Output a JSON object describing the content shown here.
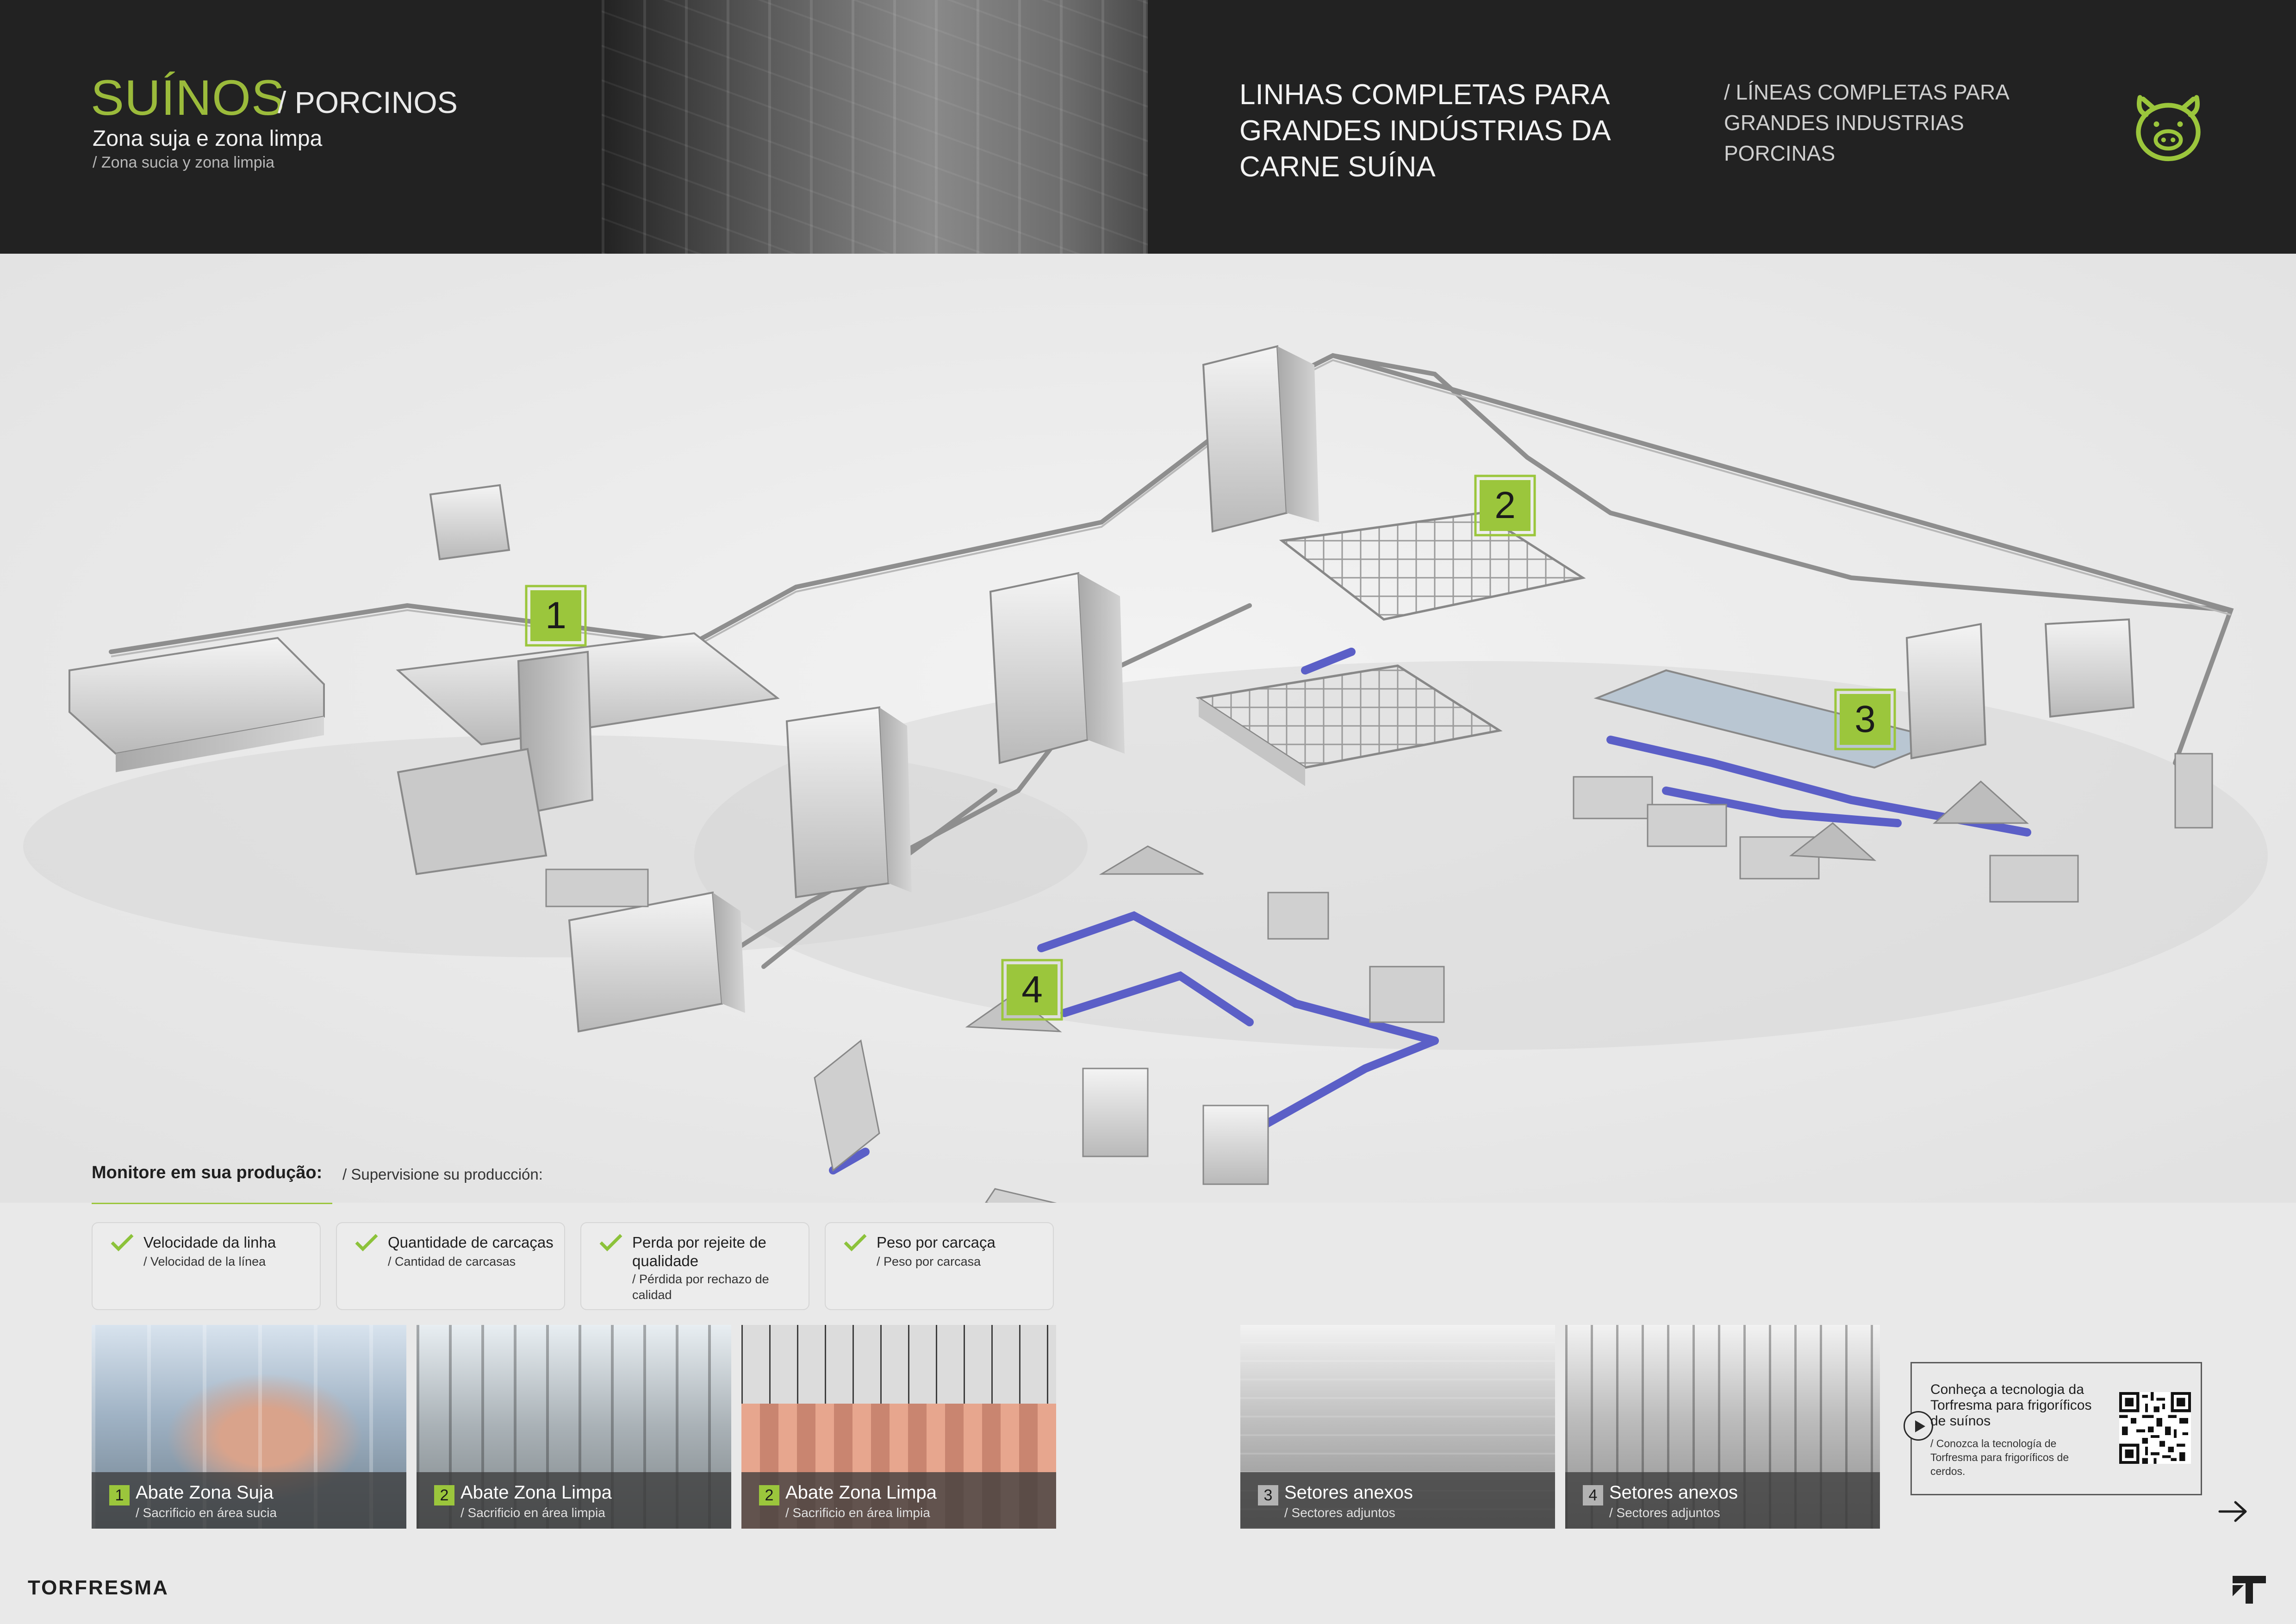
{
  "header": {
    "title_main": "SUÍNOS",
    "title_sub": "/ PORCINOS",
    "zone_pt": "Zona suja e zona limpa",
    "zone_es": "/ Zona sucia y zona limpia",
    "headline_pt": "LINHAS COMPLETAS PARA GRANDES INDÚSTRIAS DA CARNE SUÍNA",
    "headline_es": "/ LÍNEAS COMPLETAS PARA GRANDES INDUSTRIAS PORCINAS",
    "icon": "pig-icon",
    "accent_color": "#9bc63c"
  },
  "plant": {
    "markers": [
      "1",
      "2",
      "3",
      "4"
    ]
  },
  "monitor": {
    "title_pt": "Monitore em sua produção:",
    "title_es": "/ Supervisione su producción:",
    "cards": [
      {
        "pt": "Velocidade da linha",
        "es": "/ Velocidad de la línea"
      },
      {
        "pt": "Quantidade de carcaças",
        "es": "/ Cantidad de carcasas"
      },
      {
        "pt": "Perda por rejeite de qualidade",
        "es": "/ Pérdida por rechazo de calidad"
      },
      {
        "pt": "Peso por carcaça",
        "es": "/ Peso por carcasa"
      }
    ]
  },
  "tiles": [
    {
      "num": "1",
      "pt": "Abate Zona Suja",
      "es": "/ Sacrificio en área sucia"
    },
    {
      "num": "2",
      "pt": "Abate Zona Limpa",
      "es": "/ Sacrificio en área limpia"
    },
    {
      "num": "2",
      "pt": "Abate Zona Limpa",
      "es": "/ Sacrificio en área limpia"
    },
    {
      "num": "3",
      "pt": "Setores anexos",
      "es": "/ Sectores adjuntos"
    },
    {
      "num": "4",
      "pt": "Setores anexos",
      "es": "/ Sectores adjuntos"
    }
  ],
  "qr": {
    "pt": "Conheça a tecnologia da Torfresma para frigoríficos de suínos",
    "es": "/ Conozca la tecnología de Torfresma para frigoríficos de cerdos."
  },
  "footer": {
    "logo": "TORFRESMA"
  }
}
